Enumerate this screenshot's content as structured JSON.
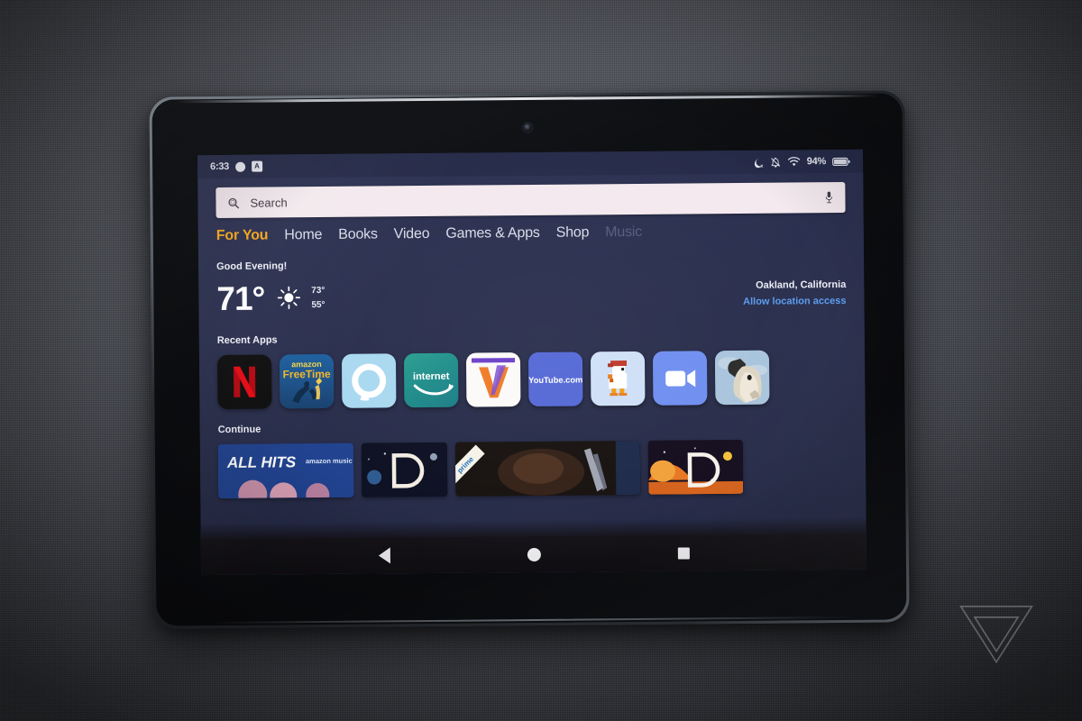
{
  "scene": {
    "watermark": "the-verge-logo",
    "background": "gray-woven-fabric"
  },
  "device": {
    "name": "Amazon Fire HD 10 tablet",
    "camera": "front-camera"
  },
  "statusbar": {
    "clock": "6:33",
    "left_icons": [
      {
        "name": "notification-dot-icon",
        "glyph": ""
      },
      {
        "name": "app-notification-badge-icon",
        "glyph": "A"
      }
    ],
    "right_icons": [
      {
        "name": "do-not-disturb-off-icon"
      },
      {
        "name": "notifications-muted-icon"
      },
      {
        "name": "wifi-icon"
      }
    ],
    "battery_percent": "94%",
    "battery_icon": "battery-icon"
  },
  "search": {
    "placeholder": "Search",
    "value": "",
    "search_icon": "search-icon",
    "mic_icon": "microphone-icon",
    "background": "#f3e9ee"
  },
  "nav_tabs": [
    {
      "label": "For You",
      "active": true
    },
    {
      "label": "Home",
      "active": false
    },
    {
      "label": "Books",
      "active": false
    },
    {
      "label": "Video",
      "active": false
    },
    {
      "label": "Games & Apps",
      "active": false
    },
    {
      "label": "Shop",
      "active": false
    },
    {
      "label": "Music",
      "active": false,
      "cut_off": true
    }
  ],
  "accent_color": "#f7a81b",
  "link_color": "#5a9cf0",
  "greeting": {
    "text": "Good Evening!"
  },
  "weather": {
    "current_temp": "71°",
    "high": "73°",
    "low": "55°",
    "condition_icon": "sunny-icon",
    "location": "Oakland, California",
    "location_link": "Allow location access"
  },
  "sections": {
    "recent_apps_title": "Recent Apps",
    "continue_title": "Continue"
  },
  "recent_apps": [
    {
      "name": "netflix",
      "label": "Netflix"
    },
    {
      "name": "amazon-freetime",
      "label": "amazon FreeTime"
    },
    {
      "name": "alexa",
      "label": "Alexa"
    },
    {
      "name": "amazon-internet",
      "label": "internet"
    },
    {
      "name": "vudu",
      "label": "Vudu"
    },
    {
      "name": "youtube-com",
      "label": "YouTube.com"
    },
    {
      "name": "crossy-road",
      "label": "Crossy Road"
    },
    {
      "name": "zoom",
      "label": "Zoom"
    },
    {
      "name": "goat-simulator",
      "label": "Goat Simulator"
    }
  ],
  "continue_cards": [
    {
      "name": "amazon-music-all-hits",
      "title": "ALL HITS",
      "brand": "amazon music"
    },
    {
      "name": "space-poster-card-1",
      "title": "D"
    },
    {
      "name": "prime-video-card",
      "badge": "prime"
    },
    {
      "name": "space-poster-card-2",
      "title": "D"
    }
  ],
  "navbar": {
    "back": "back-button",
    "home": "home-button",
    "recents": "recents-button"
  }
}
